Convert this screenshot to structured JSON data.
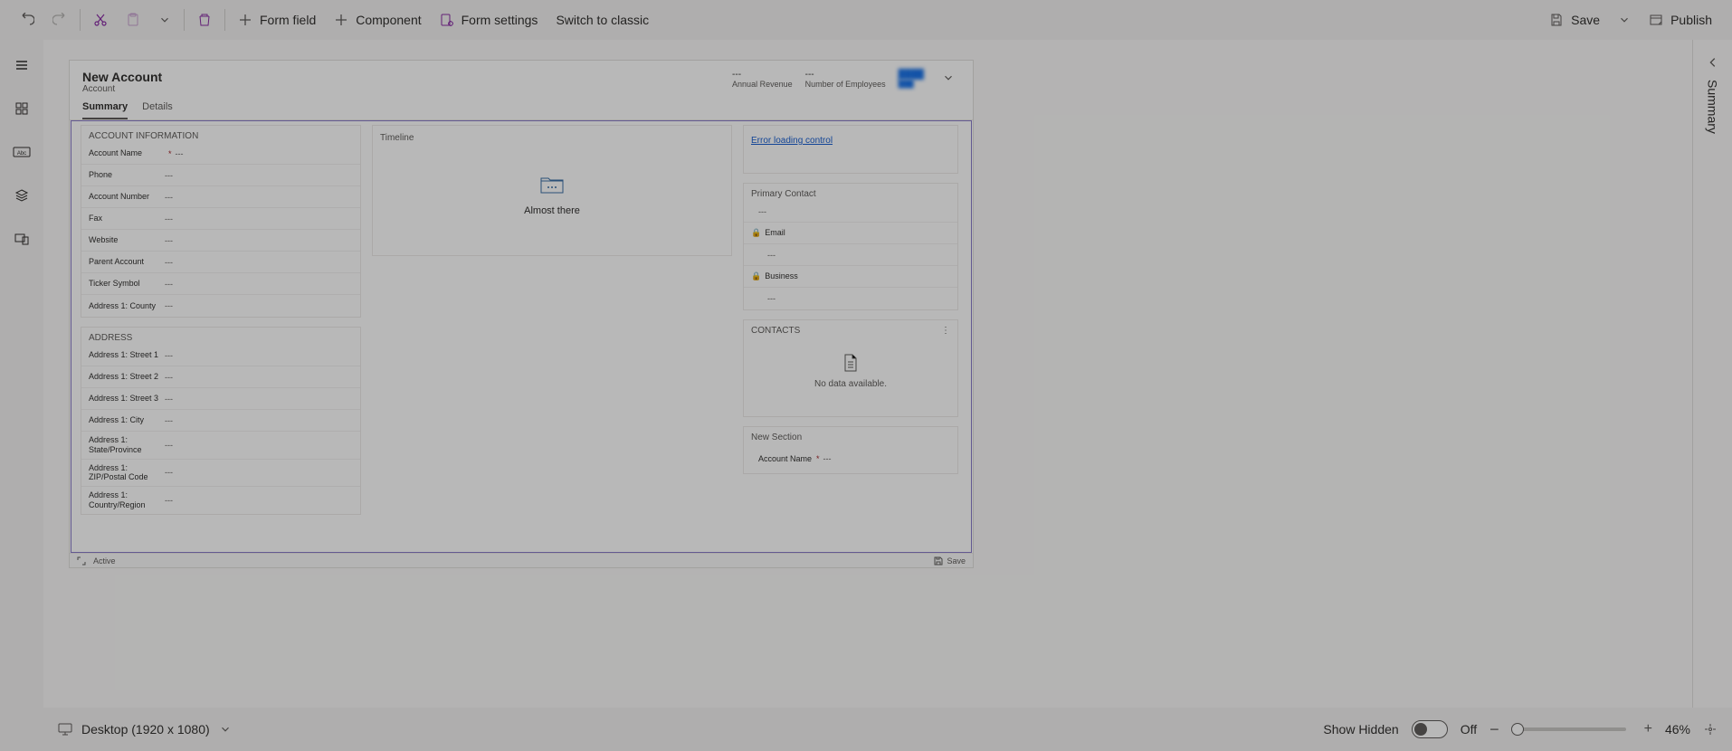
{
  "commandbar": {
    "form_field": "Form field",
    "component": "Component",
    "form_settings": "Form settings",
    "switch_classic": "Switch to classic",
    "save": "Save",
    "publish": "Publish"
  },
  "properties": {
    "title": "Summary"
  },
  "preview": {
    "title": "New Account",
    "entity": "Account",
    "header_fields": [
      {
        "label": "Annual Revenue",
        "value": "---"
      },
      {
        "label": "Number of Employees",
        "value": "---"
      }
    ],
    "tabs": [
      {
        "label": "Summary",
        "active": true
      },
      {
        "label": "Details",
        "active": false
      }
    ],
    "sections": {
      "account_info": {
        "title": "ACCOUNT INFORMATION",
        "fields": [
          {
            "label": "Account Name",
            "required": true,
            "value": "---"
          },
          {
            "label": "Phone",
            "value": "---"
          },
          {
            "label": "Account Number",
            "value": "---"
          },
          {
            "label": "Fax",
            "value": "---"
          },
          {
            "label": "Website",
            "value": "---"
          },
          {
            "label": "Parent Account",
            "value": "---"
          },
          {
            "label": "Ticker Symbol",
            "value": "---"
          },
          {
            "label": "Address 1: County",
            "value": "---"
          }
        ]
      },
      "address": {
        "title": "ADDRESS",
        "fields": [
          {
            "label": "Address 1: Street 1",
            "value": "---"
          },
          {
            "label": "Address 1: Street 2",
            "value": "---"
          },
          {
            "label": "Address 1: Street 3",
            "value": "---"
          },
          {
            "label": "Address 1: City",
            "value": "---"
          },
          {
            "label": "Address 1: State/Province",
            "value": "---"
          },
          {
            "label": "Address 1: ZIP/Postal Code",
            "value": "---"
          },
          {
            "label": "Address 1: Country/Region",
            "value": "---"
          }
        ]
      },
      "timeline": {
        "title": "Timeline",
        "message": "Almost there"
      },
      "reference_panel": {
        "error": "Error loading control",
        "primary_contact": {
          "title": "Primary Contact",
          "value": "---",
          "email_label": "Email",
          "email_value": "---",
          "business_label": "Business",
          "business_value": "---"
        },
        "contacts": {
          "title": "CONTACTS",
          "empty": "No data available."
        },
        "new_section": {
          "title": "New Section",
          "field_label": "Account Name",
          "field_value": "---"
        }
      }
    },
    "footer": {
      "status": "Active",
      "save": "Save"
    }
  },
  "footer": {
    "viewport": "Desktop (1920 x 1080)",
    "show_hidden": "Show Hidden",
    "toggle_state": "Off",
    "zoom": "46%"
  }
}
